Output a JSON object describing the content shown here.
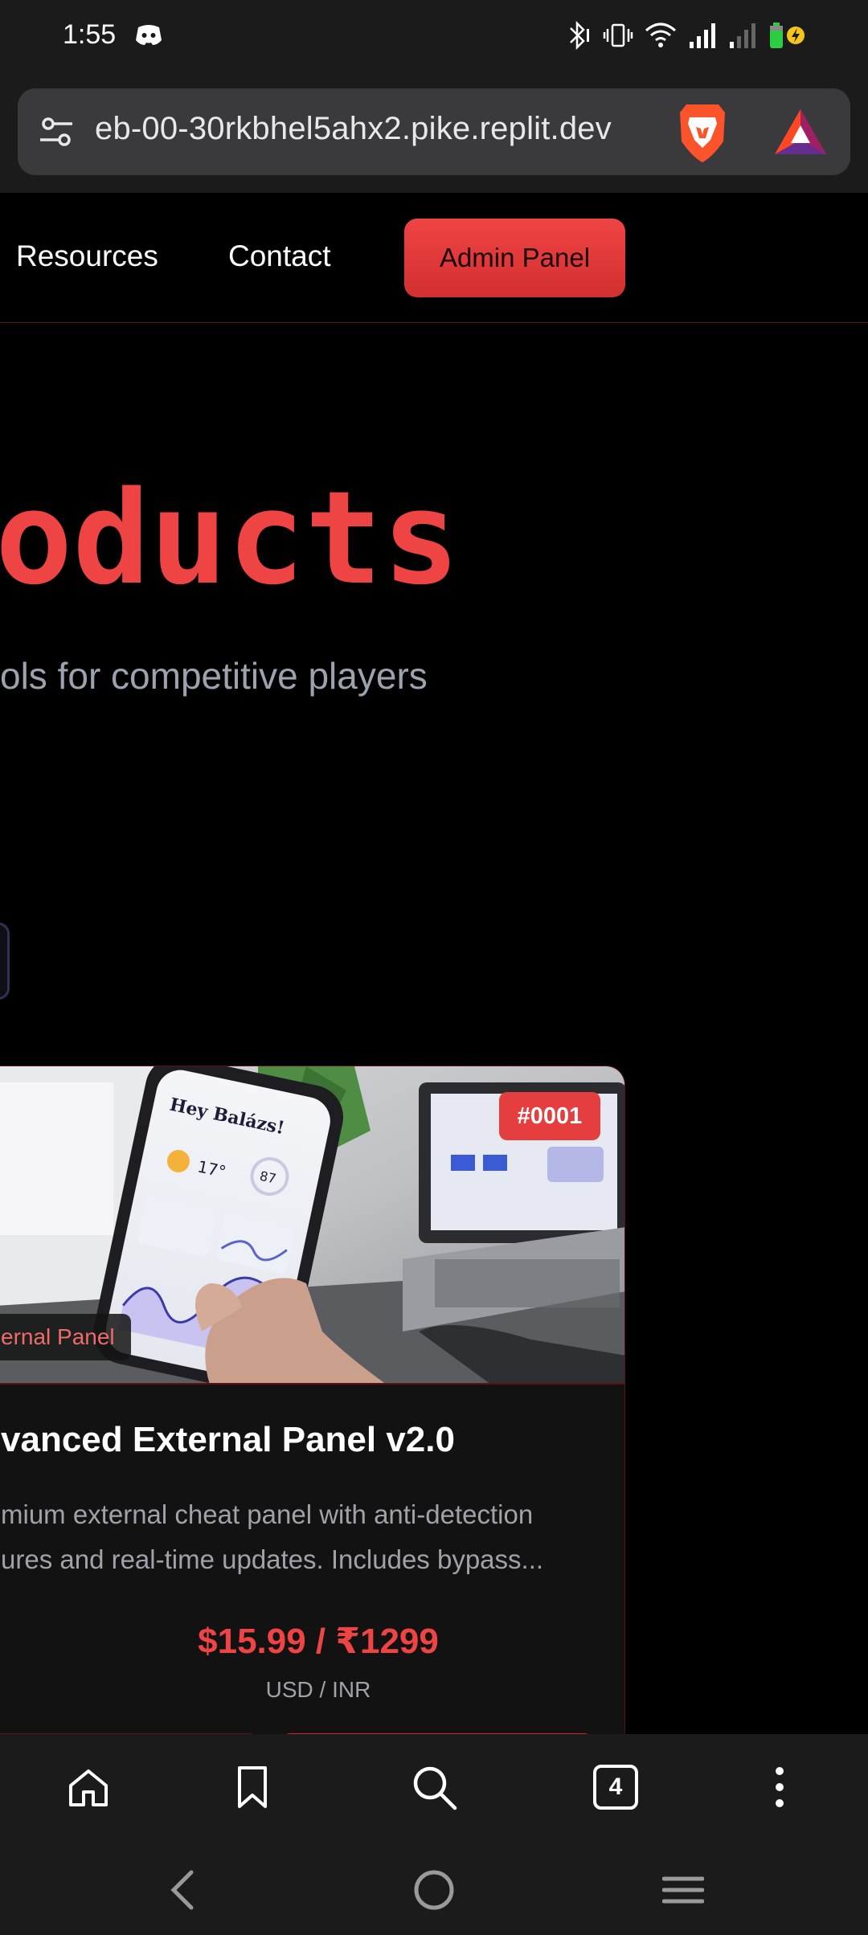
{
  "status_bar": {
    "time": "1:55",
    "icons": [
      "discord-icon",
      "bluetooth-icon",
      "vibrate-icon",
      "wifi-icon",
      "signal-icon",
      "signal-weak-icon",
      "battery-charging-icon"
    ]
  },
  "browser": {
    "url": "eb-00-30rkbhel5ahx2.pike.replit.dev",
    "tab_count": "4"
  },
  "site_nav": {
    "items": [
      {
        "label": "Resources"
      },
      {
        "label": "Contact"
      }
    ],
    "admin_label": "Admin Panel"
  },
  "hero": {
    "title": "oducts",
    "subtitle": "ols for competitive players"
  },
  "product": {
    "id": "#0001",
    "category": "ernal Panel",
    "title": "vanced External Panel v2.0",
    "description_lines": [
      "mium external cheat panel with anti-detection",
      "ures and real-time updates. Includes bypass..."
    ],
    "price": "$15.99 / ₹1299",
    "currency": "USD / INR"
  },
  "colors": {
    "accent": "#ef4444",
    "background": "#000000",
    "card": "#121212",
    "chrome": "#1b1b1b"
  }
}
